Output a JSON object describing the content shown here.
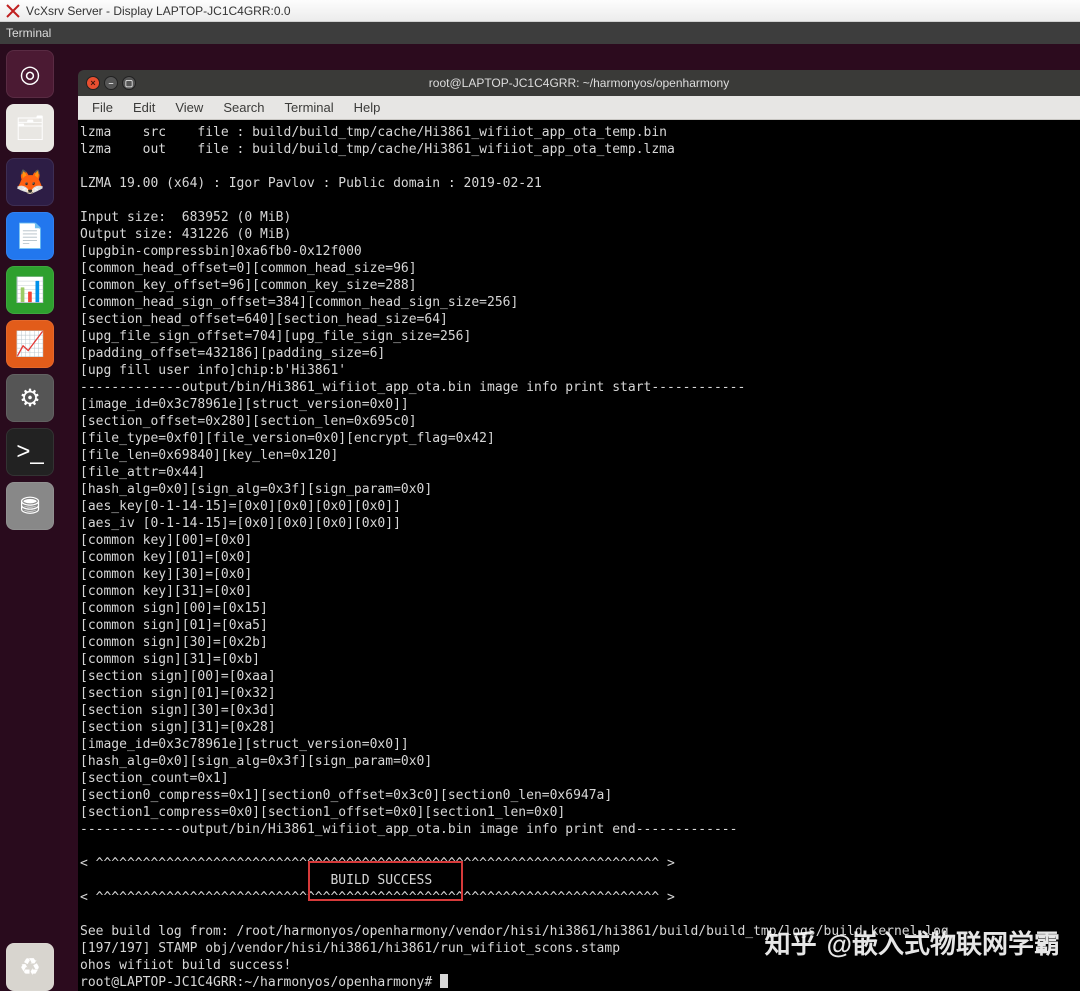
{
  "windows_title": "VcXsrv Server - Display LAPTOP-JC1C4GRR:0.0",
  "panel": {
    "title": "Terminal"
  },
  "launcher": [
    {
      "name": "dash",
      "glyph": "◎"
    },
    {
      "name": "files",
      "glyph": "🗂"
    },
    {
      "name": "firefox",
      "glyph": "🦊"
    },
    {
      "name": "writer",
      "glyph": "📄"
    },
    {
      "name": "calc",
      "glyph": "📊"
    },
    {
      "name": "impress",
      "glyph": "📈"
    },
    {
      "name": "settings",
      "glyph": "⚙"
    },
    {
      "name": "terminal",
      "glyph": ">_"
    },
    {
      "name": "disk",
      "glyph": "⛃"
    },
    {
      "name": "trash",
      "glyph": "♻"
    }
  ],
  "terminal": {
    "title": "root@LAPTOP-JC1C4GRR: ~/harmonyos/openharmony",
    "menu": [
      "File",
      "Edit",
      "View",
      "Search",
      "Terminal",
      "Help"
    ],
    "lines": [
      "lzma    src    file : build/build_tmp/cache/Hi3861_wifiiot_app_ota_temp.bin",
      "lzma    out    file : build/build_tmp/cache/Hi3861_wifiiot_app_ota_temp.lzma",
      "",
      "LZMA 19.00 (x64) : Igor Pavlov : Public domain : 2019-02-21",
      "",
      "Input size:  683952 (0 MiB)",
      "Output size: 431226 (0 MiB)",
      "[upgbin-compressbin]0xa6fb0-0x12f000",
      "[common_head_offset=0][common_head_size=96]",
      "[common_key_offset=96][common_key_size=288]",
      "[common_head_sign_offset=384][common_head_sign_size=256]",
      "[section_head_offset=640][section_head_size=64]",
      "[upg_file_sign_offset=704][upg_file_sign_size=256]",
      "[padding_offset=432186][padding_size=6]",
      "[upg fill user info]chip:b'Hi3861'",
      "-------------output/bin/Hi3861_wifiiot_app_ota.bin image info print start------------",
      "[image_id=0x3c78961e][struct_version=0x0]]",
      "[section_offset=0x280][section_len=0x695c0]",
      "[file_type=0xf0][file_version=0x0][encrypt_flag=0x42]",
      "[file_len=0x69840][key_len=0x120]",
      "[file_attr=0x44]",
      "[hash_alg=0x0][sign_alg=0x3f][sign_param=0x0]",
      "[aes_key[0-1-14-15]=[0x0][0x0][0x0][0x0]]",
      "[aes_iv [0-1-14-15]=[0x0][0x0][0x0][0x0]]",
      "[common key][00]=[0x0]",
      "[common key][01]=[0x0]",
      "[common key][30]=[0x0]",
      "[common key][31]=[0x0]",
      "[common sign][00]=[0x15]",
      "[common sign][01]=[0xa5]",
      "[common sign][30]=[0x2b]",
      "[common sign][31]=[0xb]",
      "[section sign][00]=[0xaa]",
      "[section sign][01]=[0x32]",
      "[section sign][30]=[0x3d]",
      "[section sign][31]=[0x28]",
      "[image_id=0x3c78961e][struct_version=0x0]]",
      "[hash_alg=0x0][sign_alg=0x3f][sign_param=0x0]",
      "[section_count=0x1]",
      "[section0_compress=0x1][section0_offset=0x3c0][section0_len=0x6947a]",
      "[section1_compress=0x0][section1_offset=0x0][section1_len=0x0]",
      "-------------output/bin/Hi3861_wifiiot_app_ota.bin image info print end-------------",
      "",
      "< ^^^^^^^^^^^^^^^^^^^^^^^^^^^^^^^^^^^^^^^^^^^^^^^^^^^^^^^^^^^^^^^^^^^^^^^^ >",
      "                                BUILD SUCCESS",
      "< ^^^^^^^^^^^^^^^^^^^^^^^^^^^^^^^^^^^^^^^^^^^^^^^^^^^^^^^^^^^^^^^^^^^^^^^^ >",
      "",
      "See build log from: /root/harmonyos/openharmony/vendor/hisi/hi3861/hi3861/build/build_tmp/logs/build_kernel.log",
      "[197/197] STAMP obj/vendor/hisi/hi3861/hi3861/run_wifiiot_scons.stamp",
      "ohos wifiiot build success!"
    ],
    "prompt": "root@LAPTOP-JC1C4GRR:~/harmonyos/openharmony# "
  },
  "highlight": {
    "text": "BUILD SUCCESS"
  },
  "watermark": {
    "logo": "知乎",
    "text": "@嵌入式物联网学霸"
  }
}
